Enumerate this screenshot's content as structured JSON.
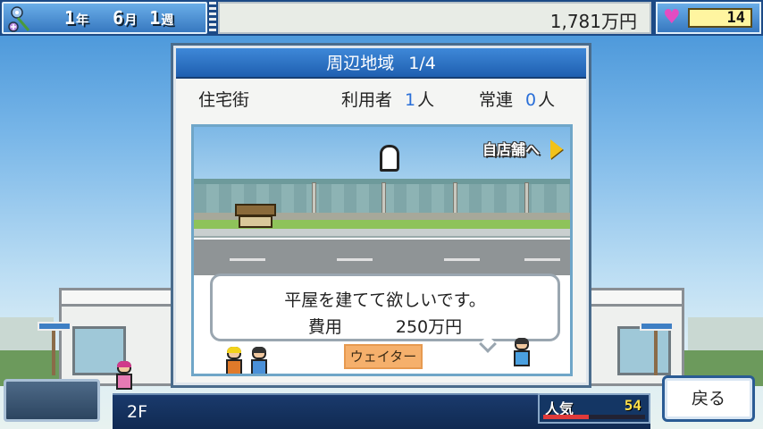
{
  "top_bar": {
    "date": {
      "year": "1",
      "year_unit": "年",
      "month": "6",
      "month_unit": "月",
      "week": "1",
      "week_unit": "週"
    },
    "money": "1,781万円",
    "hearts": "14",
    "date_icon": "flower-calendar-icon",
    "heart_icon": "heart-icon"
  },
  "dialog": {
    "title": "周辺地域",
    "page": "1/4",
    "area_name": "住宅街",
    "users_label": "利用者",
    "users_count": "1",
    "users_unit": "人",
    "regulars_label": "常連",
    "regulars_count": "0",
    "regulars_unit": "人",
    "to_shop_label": "自店舗へ",
    "request_text": "平屋を建てて欲しいです。",
    "cost_label": "費用",
    "cost_value": "250万円",
    "role_tag": "ウェイター"
  },
  "bottom_bar": {
    "floor": "2F",
    "popularity_label": "人気",
    "popularity_value": "54",
    "popularity_fill": 0.45,
    "back_label": "戻る"
  },
  "colors": {
    "title_bar": "#2e74c8",
    "count_blue": "#2a6fd8",
    "role_tag": "#f5b06c",
    "popularity_fill": "#e03a3a",
    "heart": "#e34cc2"
  }
}
